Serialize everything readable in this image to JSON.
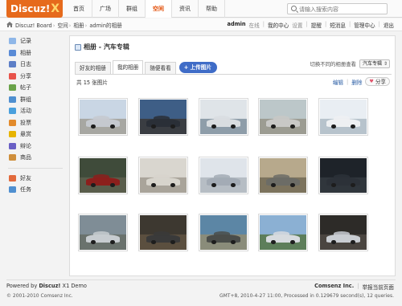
{
  "brand": {
    "logo": "Discuz!",
    "logo_mark": "X"
  },
  "nav": {
    "items": [
      {
        "label": "首页",
        "active": false
      },
      {
        "label": "广场",
        "active": false
      },
      {
        "label": "群组",
        "active": false
      },
      {
        "label": "空间",
        "active": true
      },
      {
        "label": "资讯",
        "active": false
      },
      {
        "label": "帮助",
        "active": false
      }
    ]
  },
  "search": {
    "placeholder": "请输入搜索内容"
  },
  "breadcrumb": [
    "Discuz! Board",
    "空间",
    "相册",
    "admin的相册"
  ],
  "user_nav": {
    "username": "admin",
    "status": "在线",
    "links": [
      "我的中心",
      "设置",
      "提醒",
      "短消息",
      "管理中心",
      "退出"
    ]
  },
  "sidebar": {
    "items": [
      {
        "label": "记录",
        "icon": "note-icon",
        "color": "#8fb7e8"
      },
      {
        "label": "相册",
        "icon": "photo-icon",
        "color": "#5a8bd6"
      },
      {
        "label": "日志",
        "icon": "blog-icon",
        "color": "#5d7fc7"
      },
      {
        "label": "分享",
        "icon": "share-icon",
        "color": "#e8534b"
      },
      {
        "label": "帖子",
        "icon": "post-icon",
        "color": "#6aa34a"
      },
      {
        "label": "群组",
        "icon": "group-icon",
        "color": "#4f8fd0"
      },
      {
        "label": "活动",
        "icon": "event-icon",
        "color": "#4aa0dd"
      },
      {
        "label": "投票",
        "icon": "poll-icon",
        "color": "#e28b2c"
      },
      {
        "label": "悬赏",
        "icon": "reward-icon",
        "color": "#e7b400"
      },
      {
        "label": "辩论",
        "icon": "debate-icon",
        "color": "#6a60c5"
      },
      {
        "label": "商品",
        "icon": "goods-icon",
        "color": "#cf8f3c"
      }
    ],
    "bottom_items": [
      {
        "label": "好友",
        "icon": "friend-icon",
        "color": "#e26a3c"
      },
      {
        "label": "任务",
        "icon": "task-icon",
        "color": "#4f8fd0"
      }
    ]
  },
  "main": {
    "title": "相册 - 汽车专辑",
    "tabs": [
      {
        "label": "好友的相册",
        "active": false
      },
      {
        "label": "我的相册",
        "active": true
      },
      {
        "label": "随便看看",
        "active": false
      }
    ],
    "upload_label": "+ 上传图片",
    "switch_label": "切换不同的相册查看",
    "switch_value": "汽车专辑",
    "count_text": "共 15 张图片",
    "edit_label": "编辑",
    "delete_label": "删除",
    "share_label": "分享"
  },
  "photos": [
    {
      "sky": "#c9d6e4",
      "ground": "#a7a7a2",
      "car": "#c5c9cf"
    },
    {
      "sky": "#3e5e86",
      "ground": "#3a3d42",
      "car": "#2a2f37"
    },
    {
      "sky": "#dfe4e8",
      "ground": "#8e9da9",
      "car": "#d9dde0"
    },
    {
      "sky": "#bcc7c9",
      "ground": "#9c9c92",
      "car": "#c8c8c6"
    },
    {
      "sky": "#e9eef3",
      "ground": "#b7c3cc",
      "car": "#eef0f2"
    },
    {
      "sky": "#3f4b3a",
      "ground": "#595d4b",
      "car": "#8c1f1c"
    },
    {
      "sky": "#d9d6cf",
      "ground": "#a9a49a",
      "car": "#d7d4cc"
    },
    {
      "sky": "#dfe4ea",
      "ground": "#b6bdc4",
      "car": "#a3abb5"
    },
    {
      "sky": "#b7a98c",
      "ground": "#7c735d",
      "car": "#6c6c66"
    },
    {
      "sky": "#1e2329",
      "ground": "#30363c",
      "car": "#2c3138"
    },
    {
      "sky": "#7f8d96",
      "ground": "#6a726d",
      "car": "#c7ccd0"
    },
    {
      "sky": "#3d3830",
      "ground": "#5b4f3f",
      "car": "#3a3a3a"
    },
    {
      "sky": "#5c86a5",
      "ground": "#8a8c7a",
      "car": "#4a4d4a"
    },
    {
      "sky": "#8bb0d3",
      "ground": "#5d7e5a",
      "car": "#d7dbdf"
    },
    {
      "sky": "#2d2b28",
      "ground": "#4a4540",
      "car": "#c9cdd2"
    }
  ],
  "footer": {
    "powered_prefix": "Powered by",
    "powered_product": "Discuz!",
    "powered_suffix": "X1 Demo",
    "copyright": "© 2001-2010 Comsenz Inc.",
    "company": "Comsenz Inc.",
    "report_link": "举报当前页面",
    "timing": "GMT+8, 2010-4-27 11:00, Processed in 0.129679 second(s), 12 queries."
  }
}
